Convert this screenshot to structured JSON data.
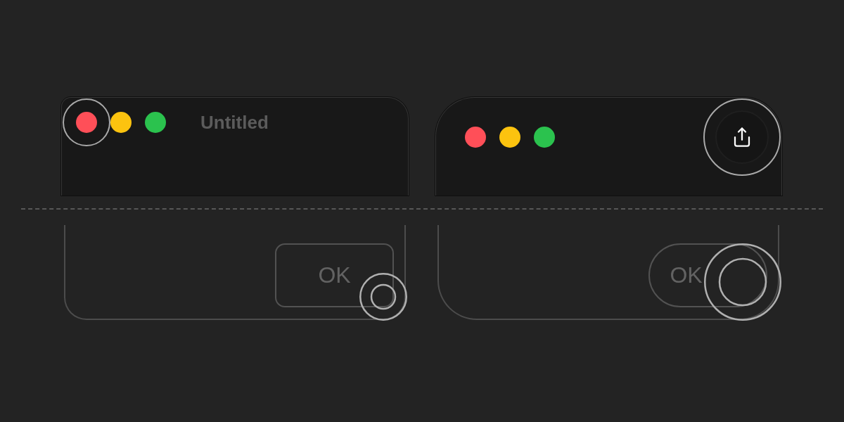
{
  "panels": [
    {
      "kind": "classic",
      "traffic_lights": [
        {
          "color": "#ff4f58"
        },
        {
          "color": "#fcc30f"
        },
        {
          "color": "#2bc24e"
        }
      ],
      "title": "Untitled",
      "button": {
        "label": "OK"
      }
    },
    {
      "kind": "modern",
      "traffic_lights": [
        {
          "color": "#ff4f58"
        },
        {
          "color": "#fcc30f"
        },
        {
          "color": "#2bc24e"
        }
      ],
      "button": {
        "label": "OK"
      }
    }
  ]
}
